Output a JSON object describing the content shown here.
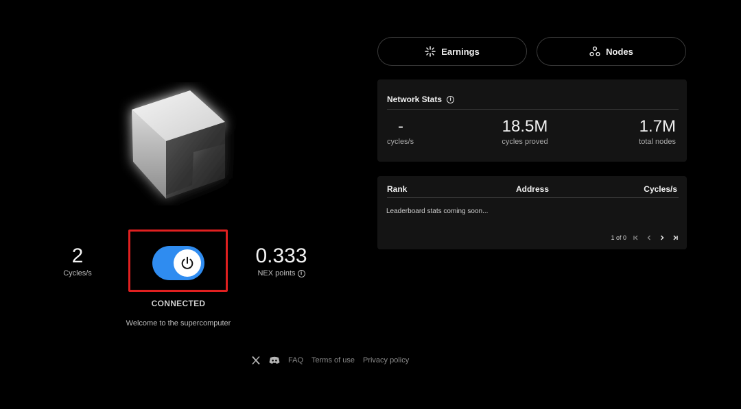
{
  "left": {
    "cycles": {
      "value": "2",
      "label": "Cycles/s"
    },
    "points": {
      "value": "0.333",
      "label": "NEX points"
    },
    "status": "CONNECTED",
    "welcome": "Welcome to the supercomputer"
  },
  "footer": {
    "icons": [
      "x-icon",
      "discord-icon"
    ],
    "links": [
      "FAQ",
      "Terms of use",
      "Privacy policy"
    ]
  },
  "tabs": {
    "earnings": "Earnings",
    "nodes": "Nodes"
  },
  "network_stats": {
    "title": "Network Stats",
    "stats": [
      {
        "value": "-",
        "label": "cycles/s"
      },
      {
        "value": "18.5M",
        "label": "cycles proved"
      },
      {
        "value": "1.7M",
        "label": "total nodes"
      }
    ]
  },
  "leaderboard": {
    "columns": [
      "Rank",
      "Address",
      "Cycles/s"
    ],
    "empty_message": "Leaderboard stats coming soon...",
    "pagination": "1 of 0"
  },
  "colors": {
    "accent": "#2f8cf0",
    "highlight": "#e02020",
    "background": "#000000",
    "card": "#141414"
  }
}
